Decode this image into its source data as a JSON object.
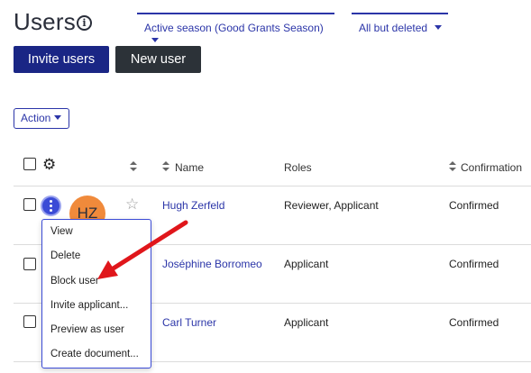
{
  "header": {
    "title": "Users",
    "info_icon": "info-icon",
    "filters": {
      "season": "Active season (Good Grants Season)",
      "status": "All but deleted"
    },
    "buttons": {
      "invite": "Invite users",
      "new_user": "New user"
    }
  },
  "toolbar": {
    "action_label": "Action"
  },
  "table": {
    "columns": {
      "name": "Name",
      "roles": "Roles",
      "confirmation": "Confirmation"
    },
    "rows": [
      {
        "name": "Hugh Zerfeld",
        "roles": "Reviewer, Applicant",
        "confirmation": "Confirmed",
        "avatar": "HZ"
      },
      {
        "name": "Joséphine Borromeo",
        "roles": "Applicant",
        "confirmation": "Confirmed"
      },
      {
        "name": "Carl Turner",
        "roles": "Applicant",
        "confirmation": "Confirmed"
      }
    ]
  },
  "context_menu": {
    "items": [
      "View",
      "Delete",
      "Block user",
      "Invite applicant...",
      "Preview as user",
      "Create document..."
    ]
  },
  "colors": {
    "accent": "#2b35a8",
    "primary_button": "#1a2685",
    "secondary_button": "#2c3238",
    "avatar": "#f08a3b",
    "annotation_arrow": "#e0161b"
  }
}
